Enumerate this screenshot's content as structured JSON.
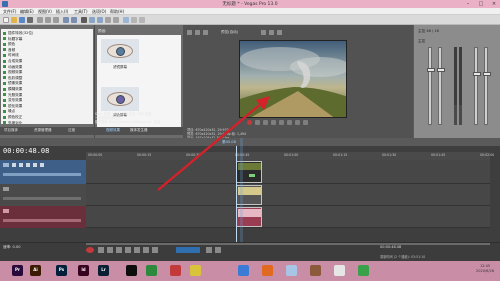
{
  "window": {
    "title": "无标题 * - Vegas Pro 13.0"
  },
  "menu": [
    "文件(F)",
    "编辑(E)",
    "视图(V)",
    "插入(I)",
    "工具(T)",
    "选项(O)",
    "帮助(H)"
  ],
  "explorer": {
    "tree_items": [
      "插件特效(32位)",
      "标题字幕",
      "颜色",
      "音频",
      "时间线",
      "合成效果",
      "动画效果",
      "视频效果",
      "色彩调整",
      "镜像效果",
      "模糊效果",
      "光照效果",
      "变形效果",
      "锐化效果",
      "噪点",
      "颜色校正",
      "亮度对比"
    ],
    "tabs": [
      "项目媒体",
      "资源管理器",
      "过渡",
      "视频效果",
      "媒体发生器"
    ],
    "presets_header": "预设:",
    "presets": [
      {
        "caption": "滤镜屏幕"
      },
      {
        "caption": "调色屏幕"
      }
    ],
    "info_lines": [
      "Sony 色调: VFX, 32 位浮点, GPU 加速",
      "一款视频效果插件。",
      "版权所有 Sony Creative Software Inc. 保留"
    ]
  },
  "preview": {
    "header_label": "预览(自动)",
    "info_lines": [
      "项目: 670x420x32, 29.970p",
      "预览: 670x420x32, 29.970p    帧: 1,494",
      "显示: 167x105x32    30.0 fps"
    ]
  },
  "mixer": {
    "header": "主控 46 / 16",
    "label": "主控"
  },
  "timeline": {
    "timecode": "00:00:48.08",
    "ruler_labels": [
      "00:00:00",
      "00:00:15",
      "00:00:30",
      "00:00:45",
      "00:01:00",
      "00:01:15",
      "00:01:30",
      "00:01:45",
      "00:02:00"
    ],
    "region_label": "第45.08",
    "rate_label": "速率: 0.00",
    "bottom_time": "00:00:48.08",
    "record_time": "录制时间 (2 个通道): 03:51:10"
  },
  "taskbar": {
    "apps": [
      {
        "short": "Pr",
        "color": "#2a0a3a"
      },
      {
        "short": "Ai",
        "color": "#3a1a00"
      },
      {
        "short": "Ps",
        "color": "#001f3a"
      },
      {
        "short": "Id",
        "color": "#3a0020"
      },
      {
        "short": "Lr",
        "color": "#0a1f33"
      },
      {
        "short": "",
        "color": "#0d0d0d"
      },
      {
        "short": "",
        "color": "#2d8a3c"
      },
      {
        "short": "",
        "color": "#c23a3a"
      },
      {
        "short": "",
        "color": "#d9c33a"
      },
      {
        "short": "",
        "color": "#3a7bd5"
      },
      {
        "short": "",
        "color": "#e06a20"
      },
      {
        "short": "",
        "color": "#a9c5e6"
      },
      {
        "short": "",
        "color": "#8a5a3a"
      },
      {
        "short": "",
        "color": "#e6e6e6"
      },
      {
        "short": "",
        "color": "#3aa04a"
      }
    ],
    "time": "12:45",
    "date": "2020/6/26"
  }
}
